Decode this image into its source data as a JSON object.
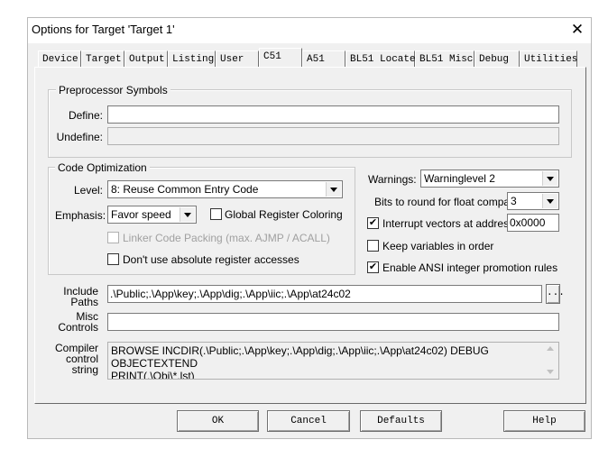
{
  "window": {
    "title": "Options for Target 'Target 1'",
    "close_glyph": "✕"
  },
  "tabs": [
    {
      "label": "Device"
    },
    {
      "label": "Target"
    },
    {
      "label": "Output"
    },
    {
      "label": "Listing"
    },
    {
      "label": "User"
    },
    {
      "label": "C51"
    },
    {
      "label": "A51"
    },
    {
      "label": "BL51 Locate"
    },
    {
      "label": "BL51 Misc"
    },
    {
      "label": "Debug"
    },
    {
      "label": "Utilities"
    }
  ],
  "active_tab": "C51",
  "preprocessor": {
    "title": "Preprocessor Symbols",
    "define_label": "Define:",
    "define_value": "",
    "undefine_label": "Undefine:",
    "undefine_value": ""
  },
  "optimization": {
    "title": "Code Optimization",
    "level_label": "Level:",
    "level_value": "8: Reuse Common Entry Code",
    "emphasis_label": "Emphasis:",
    "emphasis_value": "Favor speed",
    "global_reg_label": "Global Register Coloring",
    "global_reg_checked": false,
    "linker_packing_label": "Linker Code Packing (max. AJMP / ACALL)",
    "linker_packing_checked": false,
    "no_abs_reg_label": "Don't use absolute register accesses",
    "no_abs_reg_checked": false
  },
  "right_options": {
    "warnings_label": "Warnings:",
    "warnings_value": "Warninglevel 2",
    "bits_label": "Bits to round for float compare:",
    "bits_value": "3",
    "interrupt_label": "Interrupt vectors at address:",
    "interrupt_checked": true,
    "interrupt_value": "0x0000",
    "keep_vars_label": "Keep variables in order",
    "keep_vars_checked": false,
    "ansi_label": "Enable ANSI integer promotion rules",
    "ansi_checked": true
  },
  "paths": {
    "include_label_1": "Include",
    "include_label_2": "Paths",
    "include_value": ".\\Public;.\\App\\key;.\\App\\dig;.\\App\\iic;.\\App\\at24c02",
    "browse_label": "...",
    "misc_label_1": "Misc",
    "misc_label_2": "Controls",
    "misc_value": "",
    "compiler_label_1": "Compiler",
    "compiler_label_2": "control",
    "compiler_label_3": "string",
    "compiler_value": "BROWSE INCDIR(.\\Public;.\\App\\key;.\\App\\dig;.\\App\\iic;.\\App\\at24c02) DEBUG OBJECTEXTEND\nPRINT(.\\Obj\\*.lst)"
  },
  "buttons": {
    "ok": "OK",
    "cancel": "Cancel",
    "defaults": "Defaults",
    "help": "Help"
  },
  "check_glyph": "✔"
}
